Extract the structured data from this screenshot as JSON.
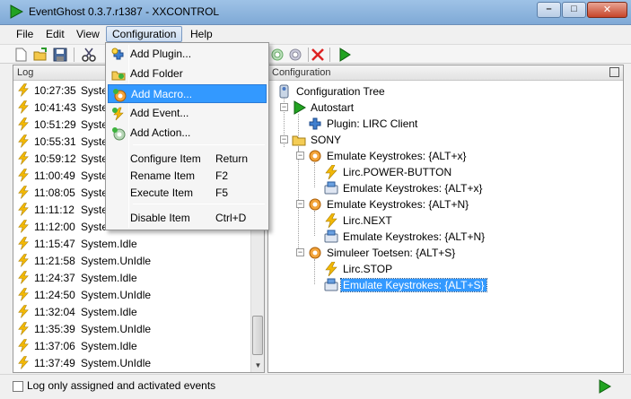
{
  "window": {
    "title": "EventGhost 0.3.7.r1387 - XXCONTROL",
    "min_label": "–",
    "max_label": "□",
    "close_label": "✕"
  },
  "menubar": {
    "items": [
      "File",
      "Edit",
      "View",
      "Configuration",
      "Help"
    ],
    "active": "Configuration"
  },
  "toolbar": {
    "icons": [
      "new-icon",
      "open-icon",
      "save-icon",
      "cut-icon",
      "copy-icon",
      "paste-icon",
      "undo-icon",
      "redo-icon",
      "add-plugin-icon",
      "add-folder-icon",
      "add-macro-icon",
      "add-event-icon",
      "add-action-icon",
      "disable-icon",
      "execute-icon"
    ]
  },
  "config_menu": {
    "items": [
      {
        "label": "Add Plugin...",
        "shortcut": "",
        "icon": "plugin-icon"
      },
      {
        "label": "Add Folder",
        "shortcut": "",
        "icon": "folder-add-icon"
      },
      {
        "label": "Add Macro...",
        "shortcut": "",
        "icon": "macro-add-icon",
        "highlighted": true
      },
      {
        "label": "Add Event...",
        "shortcut": "",
        "icon": "event-add-icon"
      },
      {
        "label": "Add Action...",
        "shortcut": "",
        "icon": "action-add-icon"
      },
      {
        "label": "Configure Item",
        "shortcut": "Return"
      },
      {
        "label": "Rename Item",
        "shortcut": "F2"
      },
      {
        "label": "Execute Item",
        "shortcut": "F5"
      },
      {
        "label": "Disable Item",
        "shortcut": "Ctrl+D"
      }
    ]
  },
  "log_panel": {
    "title": "Log",
    "rows": [
      {
        "time": "10:27:35",
        "event": "System.Idle"
      },
      {
        "time": "10:41:43",
        "event": "System.Idle"
      },
      {
        "time": "10:51:29",
        "event": "System.Idle"
      },
      {
        "time": "10:55:31",
        "event": "System.Idle"
      },
      {
        "time": "10:59:12",
        "event": "System.Idle"
      },
      {
        "time": "11:00:49",
        "event": "System.Idle"
      },
      {
        "time": "11:08:05",
        "event": "System.Idle"
      },
      {
        "time": "11:11:12",
        "event": "System.Idle"
      },
      {
        "time": "11:12:00",
        "event": "System.UnIdle"
      },
      {
        "time": "11:15:47",
        "event": "System.Idle"
      },
      {
        "time": "11:21:58",
        "event": "System.UnIdle"
      },
      {
        "time": "11:24:37",
        "event": "System.Idle"
      },
      {
        "time": "11:24:50",
        "event": "System.UnIdle"
      },
      {
        "time": "11:32:04",
        "event": "System.Idle"
      },
      {
        "time": "11:35:39",
        "event": "System.UnIdle"
      },
      {
        "time": "11:37:06",
        "event": "System.Idle"
      },
      {
        "time": "11:37:49",
        "event": "System.UnIdle"
      }
    ]
  },
  "tree_panel": {
    "title": "Configuration",
    "nodes": [
      {
        "label": "Configuration Tree",
        "icon": "tree-root-icon"
      },
      {
        "label": "Autostart",
        "icon": "autostart-icon"
      },
      {
        "label": "Plugin: LIRC Client",
        "icon": "plugin-icon"
      },
      {
        "label": "SONY",
        "icon": "folder-icon"
      },
      {
        "label": "Emulate Keystrokes: {ALT+x}",
        "icon": "macro-icon"
      },
      {
        "label": "Lirc.POWER-BUTTON",
        "icon": "event-icon"
      },
      {
        "label": "Emulate Keystrokes: {ALT+x}",
        "icon": "keyboard-action-icon"
      },
      {
        "label": "Emulate Keystrokes: {ALT+N}",
        "icon": "macro-icon"
      },
      {
        "label": "Lirc.NEXT",
        "icon": "event-icon"
      },
      {
        "label": "Emulate Keystrokes: {ALT+N}",
        "icon": "keyboard-action-icon"
      },
      {
        "label": "Simuleer Toetsen: {ALT+S}",
        "icon": "macro-icon"
      },
      {
        "label": "Lirc.STOP",
        "icon": "event-icon"
      },
      {
        "label": "Emulate Keystrokes: {ALT+S}",
        "icon": "keyboard-action-icon",
        "selected": true
      }
    ]
  },
  "statusbar": {
    "checkbox_label": "Log only assigned and activated events",
    "checked": false
  },
  "colors": {
    "selection": "#3399ff",
    "event_bolt": "#f2b807",
    "play_green": "#1e9e1e"
  }
}
